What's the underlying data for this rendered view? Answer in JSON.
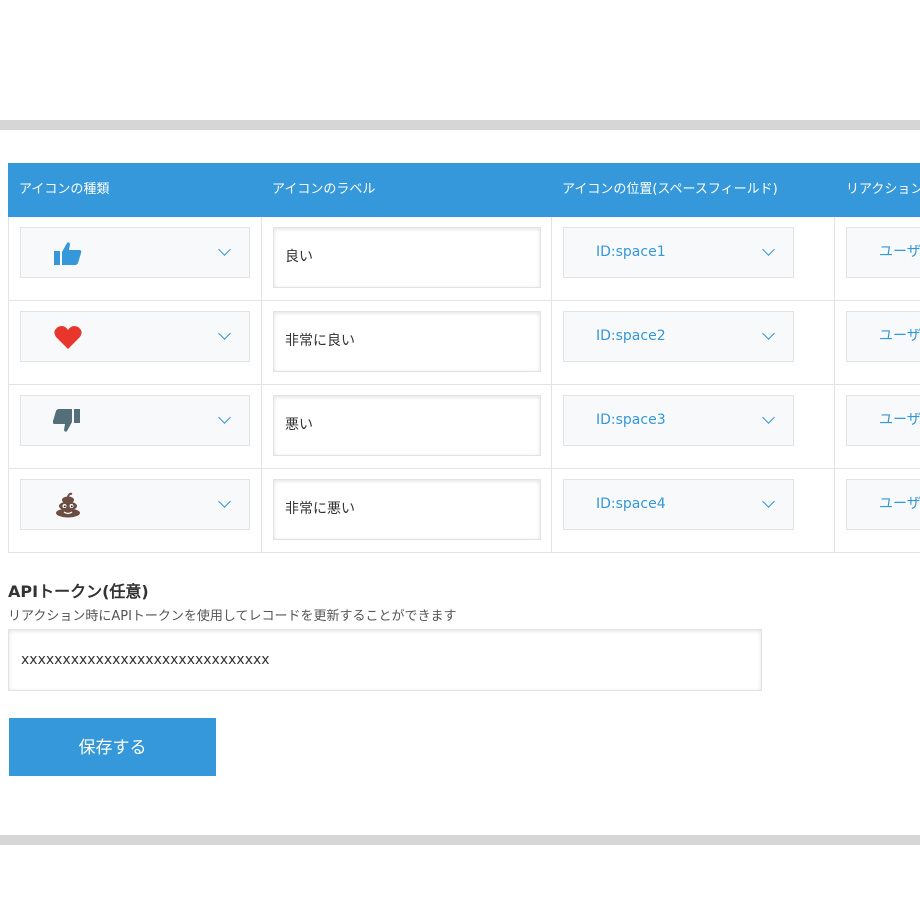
{
  "table": {
    "headers": [
      "アイコンの種類",
      "アイコンのラベル",
      "アイコンの位置(スペースフィールド)",
      "リアクション"
    ],
    "rows": [
      {
        "icon": "thumbs-up-icon",
        "label": "良い",
        "field": "ID:space1",
        "reaction": "ユーザ"
      },
      {
        "icon": "heart-icon",
        "label": "非常に良い",
        "field": "ID:space2",
        "reaction": "ユーザ"
      },
      {
        "icon": "thumbs-down-icon",
        "label": "悪い",
        "field": "ID:space3",
        "reaction": "ユーザ"
      },
      {
        "icon": "poop-icon",
        "label": "非常に悪い",
        "field": "ID:space4",
        "reaction": "ユーザ"
      }
    ]
  },
  "api": {
    "title": "APIトークン(任意)",
    "description": "リアクション時にAPIトークンを使用してレコードを更新することができます",
    "value": "xxxxxxxxxxxxxxxxxxxxxxxxxxxxxx"
  },
  "save_label": "保存する",
  "colors": {
    "accent": "#3498db",
    "heart": "#e8362d",
    "thumb_down": "#546e7a",
    "poop": "#6d4c41"
  }
}
